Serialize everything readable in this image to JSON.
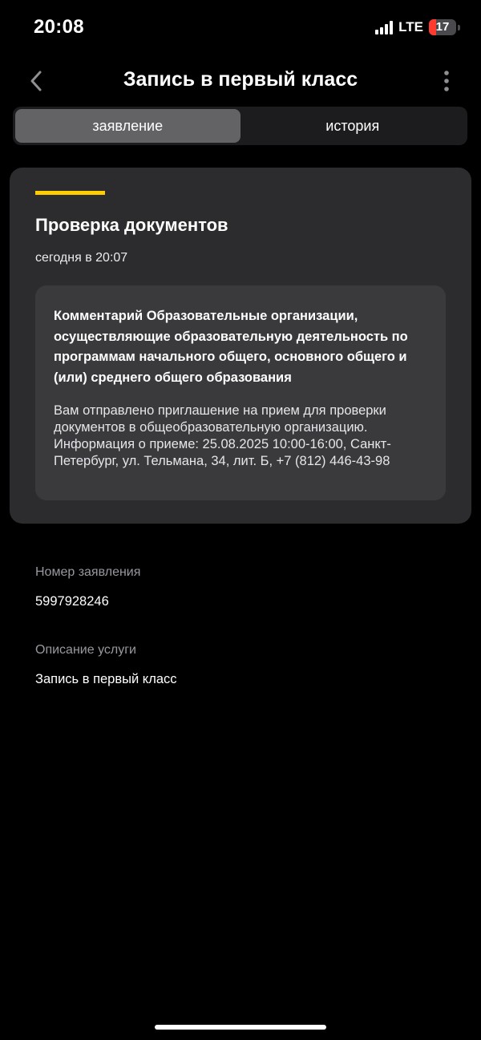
{
  "status_bar": {
    "time": "20:08",
    "network": "LTE",
    "battery_percent": "17",
    "battery_level": 0.17,
    "battery_color": "#ff3b30"
  },
  "header": {
    "title": "Запись в первый класс",
    "back_icon": "chevron-left-icon",
    "menu_icon": "more-vertical-icon"
  },
  "tabs": [
    {
      "label": "заявление",
      "active": true
    },
    {
      "label": "история",
      "active": false
    }
  ],
  "status_card": {
    "accent_color": "#ffcc00",
    "title": "Проверка документов",
    "timestamp": "сегодня в 20:07",
    "comment": {
      "title": "Комментарий Образовательные организации, осуществляющие образовательную деятельность по программам начального общего, основного общего и (или) среднего общего образования",
      "body": "Вам отправлено приглашение на прием для проверки документов в общеобразовательную организацию. Информация о приеме: 25.08.2025 10:00-16:00, Санкт-Петербург, ул. Тельмана, 34, лит. Б, +7 (812) 446-43-98"
    }
  },
  "details": {
    "application_number_label": "Номер заявления",
    "application_number": "5997928246",
    "service_description_label": "Описание услуги",
    "service_description": "Запись в первый класс"
  }
}
